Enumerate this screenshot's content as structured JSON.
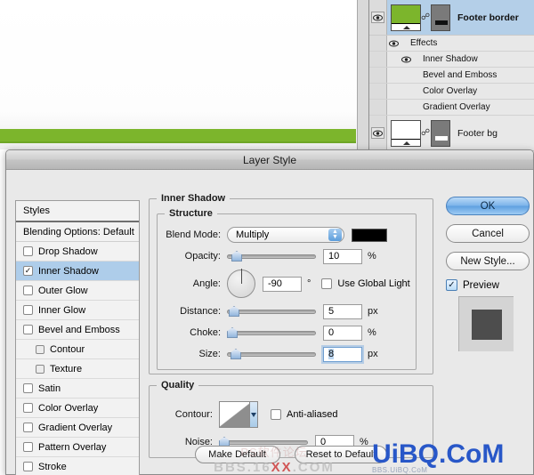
{
  "canvas": {
    "green_band_color": "#7cb52c",
    "background_color": "#ffffff"
  },
  "layers_panel": {
    "rows": [
      {
        "name": "Footer border",
        "selected": true,
        "visible": true,
        "eye_icon": "eye-icon",
        "link_icon": "link-icon"
      },
      {
        "name": "Footer bg",
        "selected": false,
        "visible": true,
        "eye_icon": "eye-icon",
        "link_icon": "link-icon"
      }
    ],
    "effects_group_label": "Effects",
    "effects": [
      {
        "label": "Inner Shadow",
        "visible": true
      },
      {
        "label": "Bevel and Emboss",
        "visible": false
      },
      {
        "label": "Color Overlay",
        "visible": false
      },
      {
        "label": "Gradient Overlay",
        "visible": false
      }
    ]
  },
  "dialog": {
    "title": "Layer Style",
    "styles": {
      "header": "Styles",
      "blending_options": "Blending Options: Default",
      "items": [
        {
          "label": "Drop Shadow",
          "checked": false,
          "active": false,
          "sub": false
        },
        {
          "label": "Inner Shadow",
          "checked": true,
          "active": true,
          "sub": false
        },
        {
          "label": "Outer Glow",
          "checked": false,
          "active": false,
          "sub": false
        },
        {
          "label": "Inner Glow",
          "checked": false,
          "active": false,
          "sub": false
        },
        {
          "label": "Bevel and Emboss",
          "checked": false,
          "active": false,
          "sub": false
        },
        {
          "label": "Contour",
          "checked": false,
          "active": false,
          "sub": true
        },
        {
          "label": "Texture",
          "checked": false,
          "active": false,
          "sub": true
        },
        {
          "label": "Satin",
          "checked": false,
          "active": false,
          "sub": false
        },
        {
          "label": "Color Overlay",
          "checked": false,
          "active": false,
          "sub": false
        },
        {
          "label": "Gradient Overlay",
          "checked": false,
          "active": false,
          "sub": false
        },
        {
          "label": "Pattern Overlay",
          "checked": false,
          "active": false,
          "sub": false
        },
        {
          "label": "Stroke",
          "checked": false,
          "active": false,
          "sub": false
        }
      ]
    },
    "panel": {
      "section_title": "Inner Shadow",
      "structure": {
        "legend": "Structure",
        "blend_mode_label": "Blend Mode:",
        "blend_mode_value": "Multiply",
        "shadow_color": "#000000",
        "opacity_label": "Opacity:",
        "opacity_value": "10",
        "opacity_unit": "%",
        "angle_label": "Angle:",
        "angle_value": "-90",
        "angle_unit": "°",
        "use_global_light_label": "Use Global Light",
        "use_global_light_checked": false,
        "distance_label": "Distance:",
        "distance_value": "5",
        "distance_unit": "px",
        "choke_label": "Choke:",
        "choke_value": "0",
        "choke_unit": "%",
        "size_label": "Size:",
        "size_value": "8",
        "size_unit": "px"
      },
      "quality": {
        "legend": "Quality",
        "contour_label": "Contour:",
        "anti_aliased_label": "Anti-aliased",
        "anti_aliased_checked": false,
        "noise_label": "Noise:",
        "noise_value": "0",
        "noise_unit": "%"
      },
      "make_default": "Make Default",
      "reset_to_default": "Reset to Default"
    },
    "buttons": {
      "ok": "OK",
      "cancel": "Cancel",
      "new_style": "New Style...",
      "preview_label": "Preview",
      "preview_checked": true
    }
  },
  "watermarks": {
    "faint_line1": "PS软件论坛",
    "faint_line2_a": "BBS.16",
    "faint_line2_b": "XX",
    "faint_line2_c": ".COM",
    "blue_main": "UiBQ.CoM",
    "blue_sub": "BBS.UiBQ.CoM"
  }
}
